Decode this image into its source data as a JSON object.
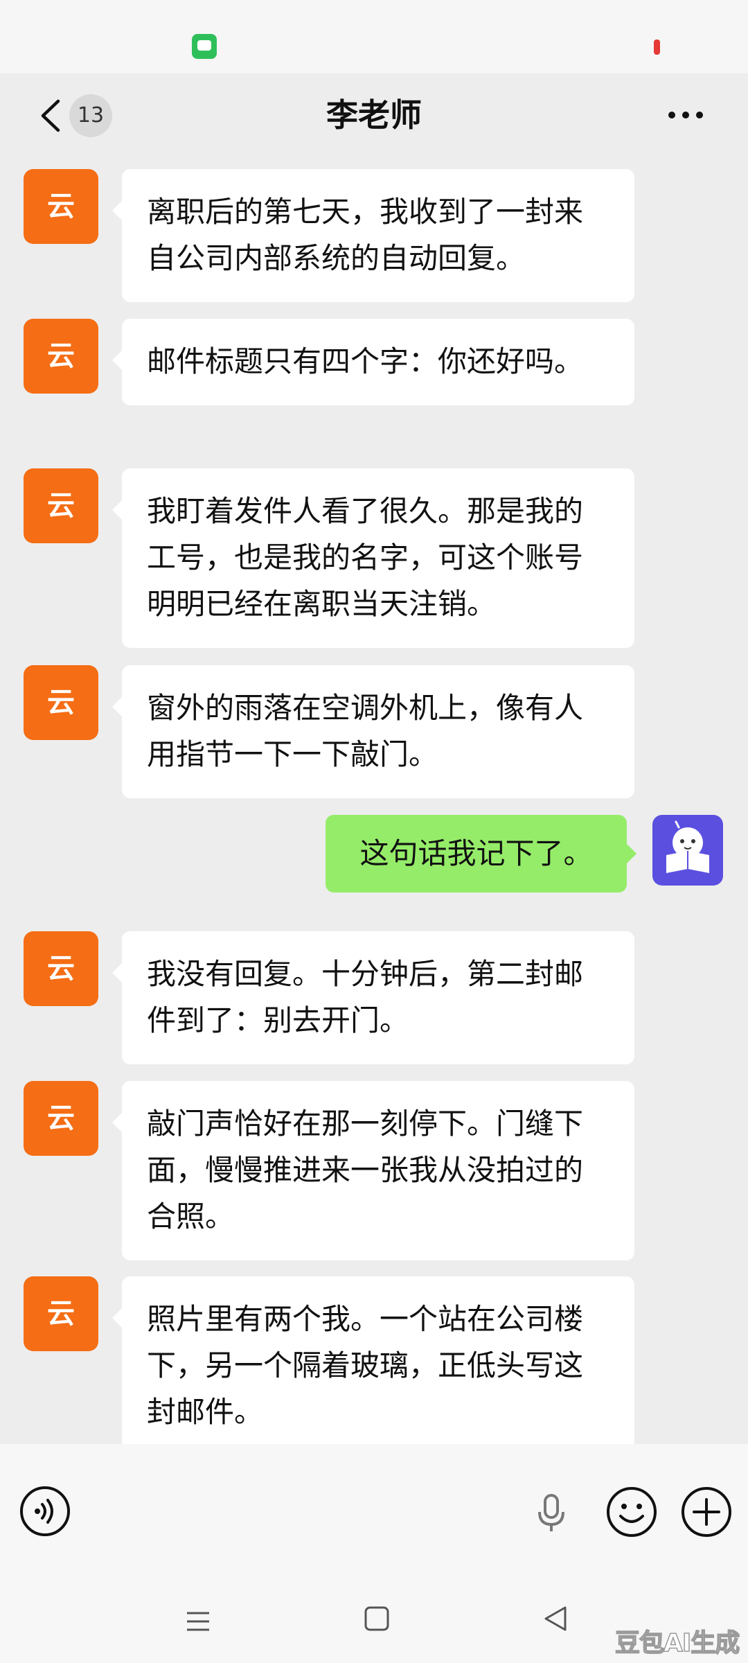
{
  "header": {
    "title": "李老师",
    "unread_count": "13"
  },
  "messages": [
    {
      "from": "other",
      "avatar_text": "云",
      "text": "离职后的第七天，我收到了一封来自公司内部系统的自动回复。"
    },
    {
      "from": "other",
      "avatar_text": "云",
      "text": "邮件标题只有四个字：你还好吗。"
    },
    {
      "from": "other",
      "avatar_text": "云",
      "text": "我盯着发件人看了很久。那是我的工号，也是我的名字，可这个账号明明已经在离职当天注销。"
    },
    {
      "from": "other",
      "avatar_text": "云",
      "text": "窗外的雨落在空调外机上，像有人用指节一下一下敲门。"
    },
    {
      "from": "me",
      "text": "这句话我记下了。"
    },
    {
      "from": "other",
      "avatar_text": "云",
      "text": "我没有回复。十分钟后，第二封邮件到了：别去开门。"
    },
    {
      "from": "other",
      "avatar_text": "云",
      "text": "敲门声恰好在那一刻停下。门缝下面，慢慢推进来一张我从没拍过的合照。"
    },
    {
      "from": "other",
      "avatar_text": "云",
      "text": "照片里有两个我。一个站在公司楼下，另一个隔着玻璃，正低头写这封邮件。"
    }
  ],
  "watermark": "豆包AI生成",
  "colors": {
    "background": "#ededed",
    "incoming_bubble": "#ffffff",
    "outgoing_bubble": "#95ec69",
    "avatar_orange": "#f56d14",
    "avatar_purple": "#5b4fe0"
  },
  "icons": [
    "back-icon",
    "more-icon",
    "voice-icon",
    "mic-icon",
    "emoji-icon",
    "plus-icon",
    "menu-icon",
    "home-icon",
    "back-triangle-icon"
  ]
}
